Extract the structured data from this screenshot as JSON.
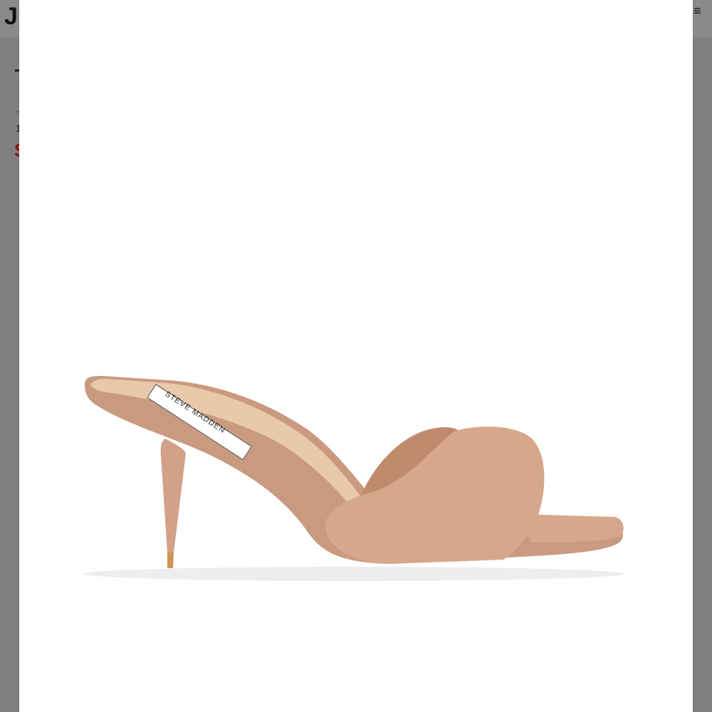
{
  "background_page": {
    "logo_fragment": "J",
    "menu_fragment": "≡",
    "title_fragment": "T",
    "small_line_1": "·",
    "small_line_2": "1",
    "price_fragment": "S"
  },
  "product_image": {
    "brand_label": "STEVE MADDEN",
    "colors": {
      "upper": "#d6a78b",
      "upper_shadow": "#c08a6d",
      "sole": "#c99a80",
      "insole": "#e9c8ab",
      "heel": "#d3a088",
      "heel_tip": "#cf9552"
    }
  }
}
